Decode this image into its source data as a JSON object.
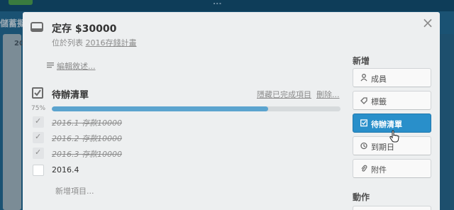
{
  "background": {
    "board_title": "...",
    "board_name": "儲蓄擬,",
    "list_number": "20"
  },
  "card": {
    "title": "定存 $30000",
    "in_list_prefix": "位於列表",
    "list_name": "2016存錢計畫",
    "edit_description": "編輯敘述..."
  },
  "checklist": {
    "title": "待辦清單",
    "hide_completed": "隱藏已完成項目",
    "delete": "刪除...",
    "progress_label": "75%",
    "progress": 0.75,
    "items": [
      {
        "text": "2016.1 存款10000",
        "checked": true
      },
      {
        "text": "2016.2 存款10000",
        "checked": true
      },
      {
        "text": "2016.3 存款10000",
        "checked": true
      },
      {
        "text": "2016.4",
        "checked": false
      }
    ],
    "add_item": "新增項目..."
  },
  "sidebar": {
    "add_heading": "新增",
    "buttons": [
      {
        "label": "成員",
        "icon": "person-icon"
      },
      {
        "label": "標籤",
        "icon": "tag-icon"
      },
      {
        "label": "待辦清單",
        "icon": "checklist-icon",
        "active": true
      },
      {
        "label": "到期日",
        "icon": "clock-icon"
      },
      {
        "label": "附件",
        "icon": "paperclip-icon"
      }
    ],
    "actions_heading": "動作"
  },
  "colors": {
    "accent": "#298fca",
    "progress_fill": "#5ba4cf",
    "modal_bg": "#edeff0"
  }
}
